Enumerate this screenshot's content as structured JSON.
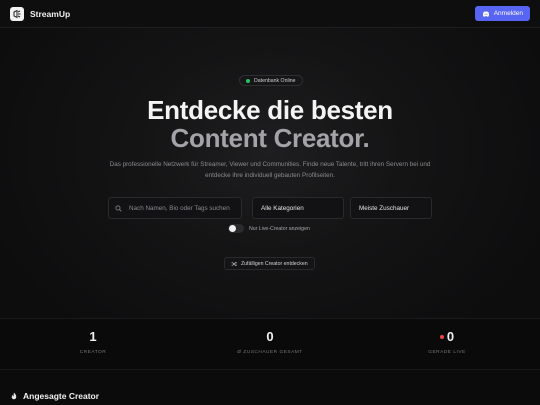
{
  "navbar": {
    "brand": "StreamUp",
    "login_label": "Anmelden"
  },
  "hero": {
    "status_text": "Datenbank Online",
    "headline_line1": "Entdecke die besten",
    "headline_line2": "Content Creator.",
    "subtitle": "Das professionelle Netzwerk für Streamer, Viewer und Communities. Finde neue Talente, tritt ihren Servern bei und entdecke ihre individuell gebauten Profilseiten."
  },
  "filters": {
    "search_placeholder": "Nach Namen, Bio oder Tags suchen",
    "category_selected": "Alle Kategorien",
    "sort_selected": "Meiste Zuschauer",
    "live_toggle_label": "Nur Live-Creator anzeigen",
    "live_toggle_on": false,
    "random_button_label": "Zufälligen Creator entdecken"
  },
  "stats": [
    {
      "value": "1",
      "label": "CREATOR"
    },
    {
      "value": "0",
      "label": "Ø ZUSCHAUER GESAMT"
    },
    {
      "value": "0",
      "label": "GERADE LIVE"
    }
  ],
  "featured": {
    "title": "Angesagte Creator"
  },
  "colors": {
    "accent": "#5865f2",
    "online": "#22c55e",
    "live": "#ef4444"
  },
  "icons": {
    "logo": "streamup-logo-icon",
    "login": "discord-icon",
    "search": "search-icon",
    "random": "shuffle-icon",
    "featured": "fire-icon"
  }
}
